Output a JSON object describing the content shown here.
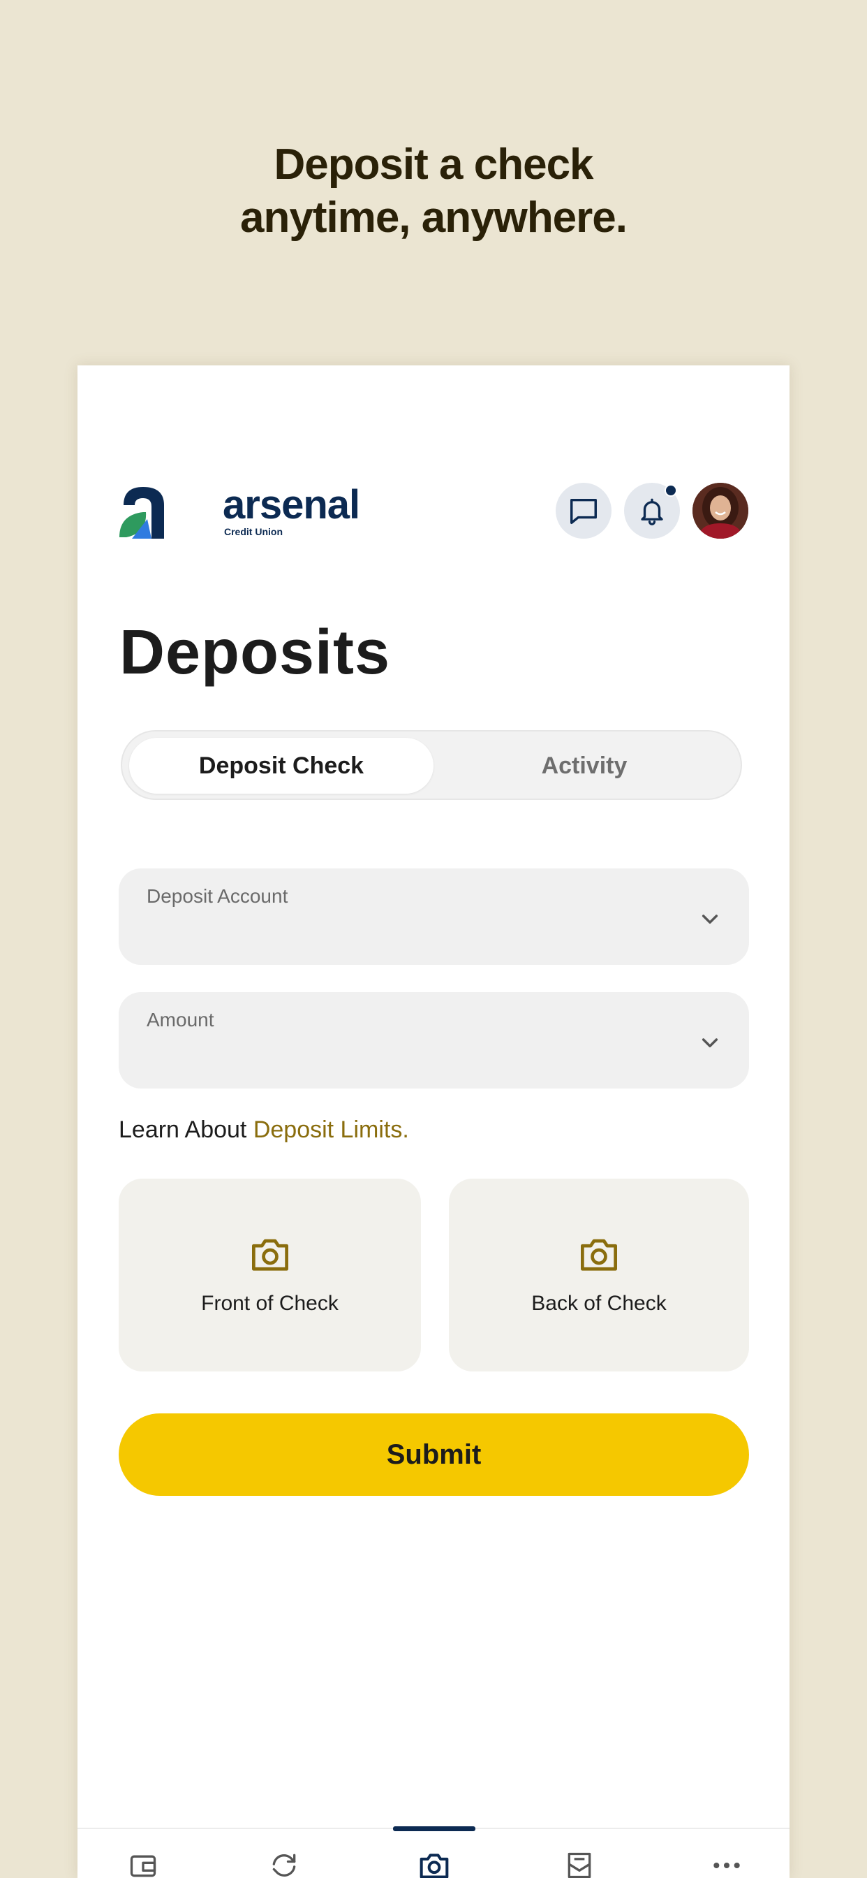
{
  "headline": {
    "line1": "Deposit a check",
    "line2": "anytime, anywhere."
  },
  "brand": {
    "name": "arsenal",
    "subtitle": "Credit Union",
    "colors": {
      "navy": "#0c2a52",
      "green": "#2e9a5e",
      "blue": "#2f7be0"
    }
  },
  "header": {
    "chat_icon": "chat-icon",
    "bell_icon": "bell-icon",
    "has_notification": true
  },
  "page": {
    "title": "Deposits"
  },
  "tabs": [
    {
      "label": "Deposit Check",
      "active": true
    },
    {
      "label": "Activity",
      "active": false
    }
  ],
  "form": {
    "deposit_account": {
      "label": "Deposit Account",
      "value": ""
    },
    "amount": {
      "label": "Amount",
      "value": ""
    },
    "learn_prefix": "Learn About ",
    "learn_link": "Deposit Limits.",
    "front_label": "Front of Check",
    "back_label": "Back of Check",
    "submit_label": "Submit"
  },
  "bottom_nav": {
    "items": [
      {
        "icon": "wallet-icon",
        "active": false
      },
      {
        "icon": "transfer-icon",
        "active": false
      },
      {
        "icon": "camera-icon",
        "active": true
      },
      {
        "icon": "inbox-icon",
        "active": false
      },
      {
        "icon": "more-icon",
        "active": false
      }
    ]
  },
  "colors": {
    "background": "#ebe5d2",
    "accent_yellow": "#f5c800",
    "link_gold": "#8a6d0d",
    "navy": "#0c2a52"
  }
}
